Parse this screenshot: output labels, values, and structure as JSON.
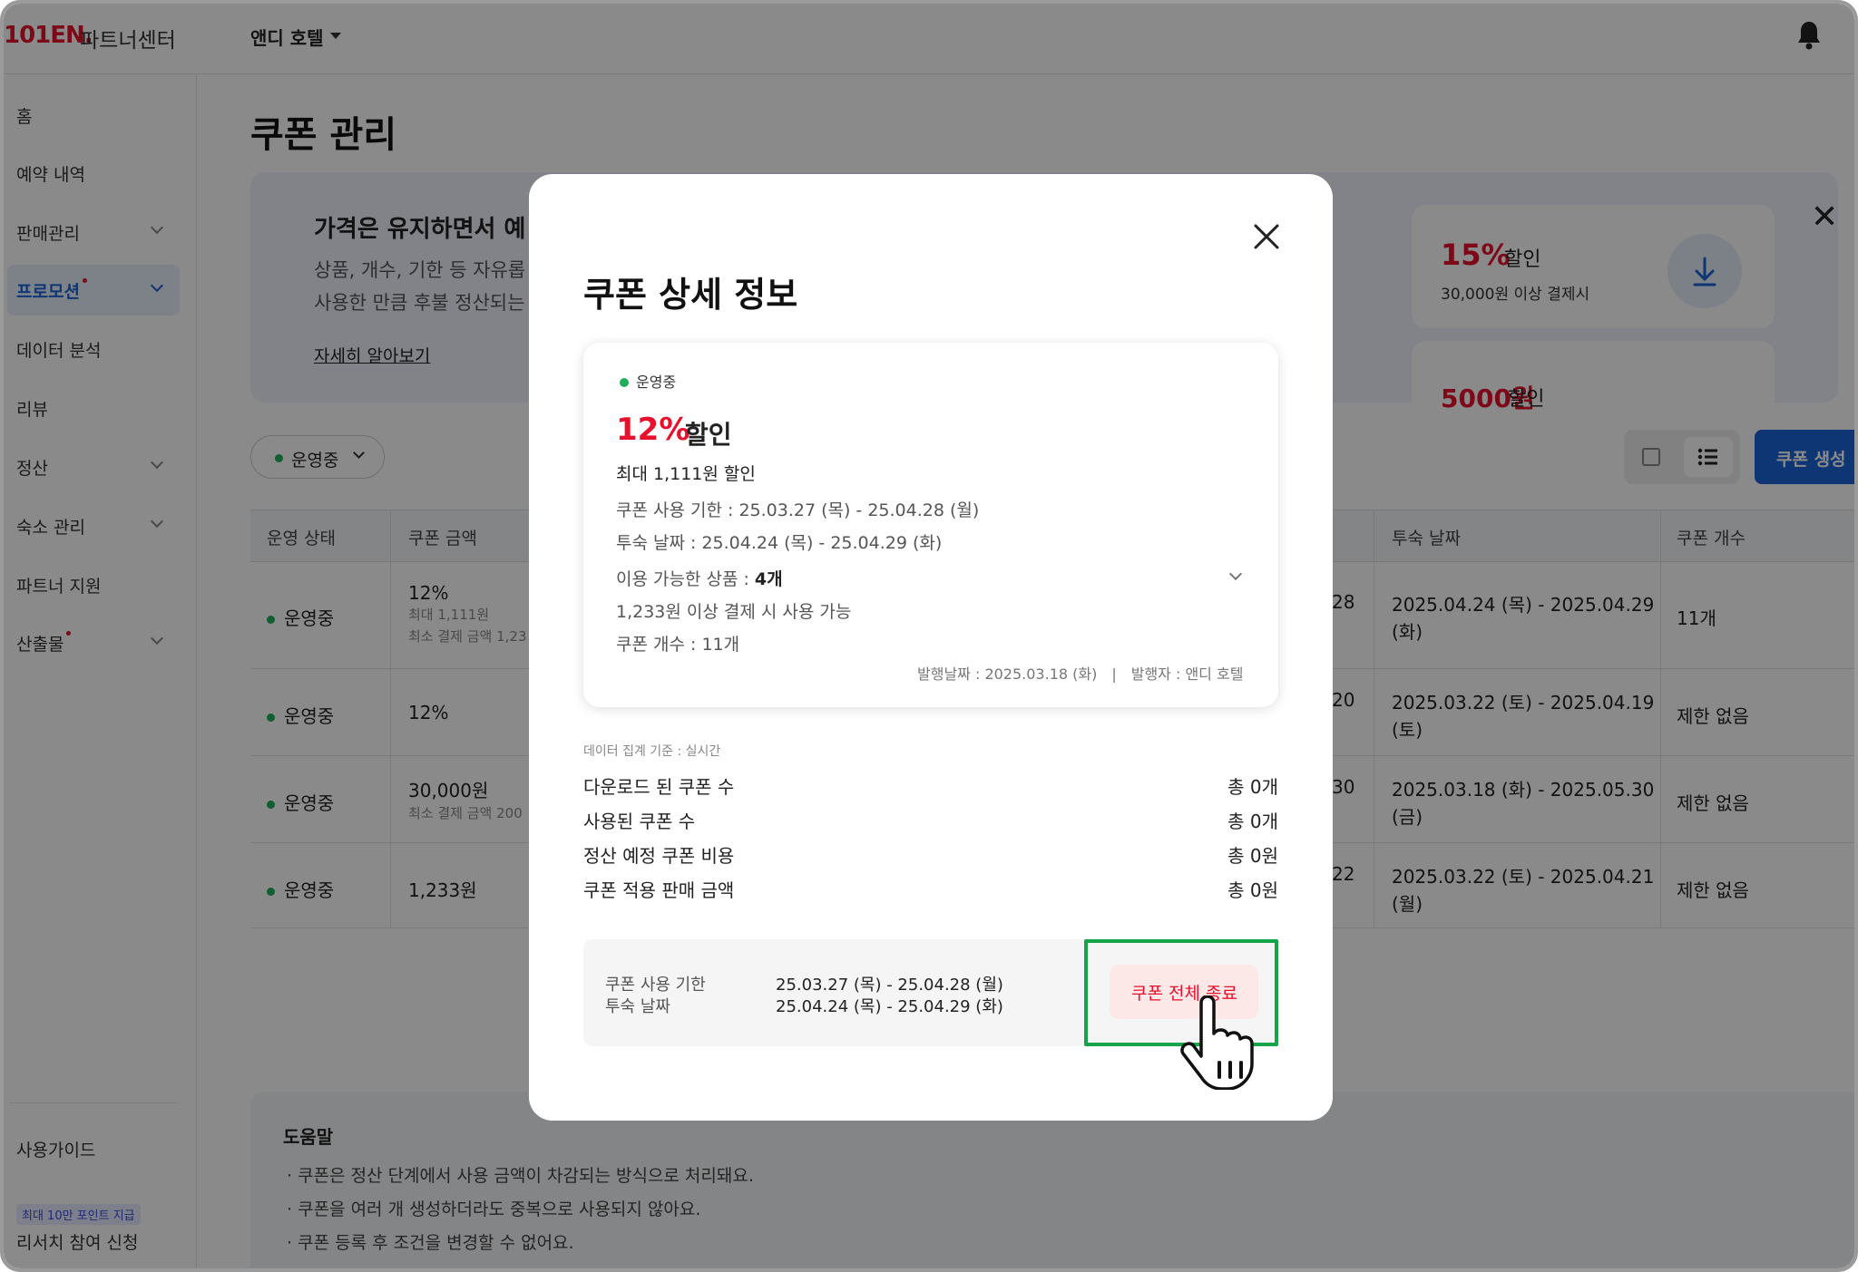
{
  "header": {
    "logo": "101EN.",
    "logo_sub": "파트너센터",
    "hotel_name": "앤디 호텔"
  },
  "sidebar": {
    "items": [
      {
        "label": "홈",
        "chevron": false,
        "dot": false
      },
      {
        "label": "예약 내역",
        "chevron": false,
        "dot": false
      },
      {
        "label": "판매관리",
        "chevron": true,
        "dot": false
      },
      {
        "label": "프로모션",
        "chevron": true,
        "dot": true,
        "active": true
      },
      {
        "label": "데이터 분석",
        "chevron": false,
        "dot": false
      },
      {
        "label": "리뷰",
        "chevron": false,
        "dot": false
      },
      {
        "label": "정산",
        "chevron": true,
        "dot": false
      },
      {
        "label": "숙소 관리",
        "chevron": true,
        "dot": false
      },
      {
        "label": "파트너 지원",
        "chevron": false,
        "dot": false
      },
      {
        "label": "산출물",
        "chevron": true,
        "dot": true
      }
    ],
    "guide": "사용가이드",
    "research_badge": "최대 10만 포인트 지급",
    "research": "리서치 참여 신청"
  },
  "main": {
    "title": "쿠폰 관리",
    "banner": {
      "title": "가격은 유지하면서 예",
      "desc1": "상품, 개수, 기한 등 자유롭",
      "desc2": "사용한 만큼 후불 정산되는",
      "link": "자세히 알아보기",
      "promo1_pct": "15%",
      "promo1_tag": "할인",
      "promo1_cond": "30,000원 이상 결제시",
      "promo2_pct": "5000원",
      "promo2_tag": "할인"
    },
    "filter_label": "운영중",
    "create_button": "쿠폰 생성",
    "table": {
      "headers": [
        "운영 상태",
        "쿠폰 금액",
        "투숙 날짜",
        "쿠폰 개수"
      ],
      "rows": [
        {
          "status": "운영중",
          "amount": "12%",
          "amount_sub1": "최대 1,111원",
          "amount_sub2": "최소 결제 금액 1,23",
          "mid": "28",
          "stay1": "2025.04.24 (목) - 2025.04.29",
          "stay2": "(화)",
          "count": "11개"
        },
        {
          "status": "운영중",
          "amount": "12%",
          "amount_sub1": "",
          "amount_sub2": "",
          "mid": "20",
          "stay1": "2025.03.22 (토) - 2025.04.19",
          "stay2": "(토)",
          "count": "제한 없음"
        },
        {
          "status": "운영중",
          "amount": "30,000원",
          "amount_sub1": "최소 결제 금액 200",
          "amount_sub2": "",
          "mid": "30",
          "stay1": "2025.03.18 (화) - 2025.05.30",
          "stay2": "(금)",
          "count": "제한 없음"
        },
        {
          "status": "운영중",
          "amount": "1,233원",
          "amount_sub1": "",
          "amount_sub2": "",
          "mid": "22",
          "stay1": "2025.03.22 (토) - 2025.04.21",
          "stay2": "(월)",
          "count": "제한 없음"
        }
      ]
    },
    "help": {
      "title": "도움말",
      "items": [
        "쿠폰은 정산 단계에서 사용 금액이 차감되는 방식으로 처리돼요.",
        "쿠폰을 여러 개 생성하더라도 중복으로 사용되지 않아요.",
        "쿠폰 등록 후 조건을 변경할 수 없어요."
      ]
    }
  },
  "modal": {
    "title": "쿠폰 상세 정보",
    "status": "운영중",
    "discount_pct": "12%",
    "discount_tag": "할인",
    "max_discount": "최대 1,111원 할인",
    "use_period": "쿠폰 사용 기한 : 25.03.27 (목) - 25.04.28 (월)",
    "stay_period": "투숙 날짜 : 25.04.24 (목) - 25.04.29 (화)",
    "products_label": "이용 가능한 상품 : ",
    "products_count": "4개",
    "min_payment": "1,233원 이상 결제 시 사용 가능",
    "coupon_count": "쿠폰 개수 : 11개",
    "issue_date": "발행날짜 : 2025.03.18 (화)",
    "issuer": "발행자 : 앤디 호텔",
    "aggregation_note": "데이터 집계 기준 : 실시간",
    "stats": [
      {
        "label": "다운로드 된 쿠폰 수",
        "value": "총 0개"
      },
      {
        "label": "사용된 쿠폰 수",
        "value": "총 0개"
      },
      {
        "label": "정산 예정 쿠폰 비용",
        "value": "총 0원"
      },
      {
        "label": "쿠폰 적용 판매 금액",
        "value": "총 0원"
      }
    ],
    "bottom": {
      "label1": "쿠폰 사용 기한",
      "label2": "투숙 날짜",
      "value1": "25.03.27 (목) - 25.04.28 (월)",
      "value2": "25.04.24 (목) - 25.04.29 (화)",
      "end_button": "쿠폰 전체 종료"
    }
  },
  "colors": {
    "accent_red": "#e8112d",
    "status_green": "#1fae5b",
    "primary_blue": "#1a62d6",
    "highlight_green": "#16a34a"
  }
}
